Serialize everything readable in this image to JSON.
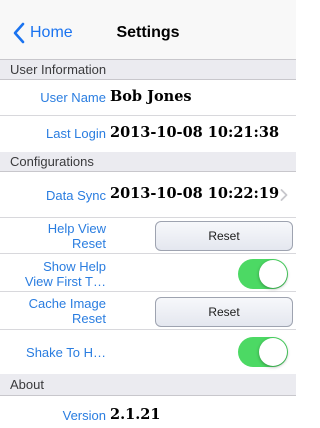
{
  "nav": {
    "back_label": "Home",
    "title": "Settings"
  },
  "sections": {
    "user_information": "User Information",
    "configurations": "Configurations",
    "about": "About"
  },
  "user_info": {
    "user_name_label": "User Name",
    "user_name_value": "Bob Jones",
    "last_login_label": "Last Login",
    "last_login_value": "2013-10-08 10:21:38"
  },
  "config": {
    "data_sync_label": "Data Sync",
    "data_sync_value": "2013-10-08 10:22:19",
    "help_view_reset_label_line1": "Help View",
    "help_view_reset_label_line2": "Reset",
    "help_view_reset_button": "Reset",
    "show_help_label_line1": "Show Help",
    "show_help_label_line2": "View First T…",
    "show_help_on": true,
    "cache_image_reset_label_line1": "Cache Image",
    "cache_image_reset_label_line2": "Reset",
    "cache_image_reset_button": "Reset",
    "shake_label": "Shake To H…",
    "shake_on": true
  },
  "about": {
    "version_label": "Version",
    "version_value": "2.1.21"
  },
  "colors": {
    "accent": "#2a7de0",
    "toggle_on": "#4cd964",
    "section_bg": "#ebebf0"
  },
  "icons": {
    "back": "chevron-left-icon",
    "disclosure": "chevron-right-icon"
  }
}
